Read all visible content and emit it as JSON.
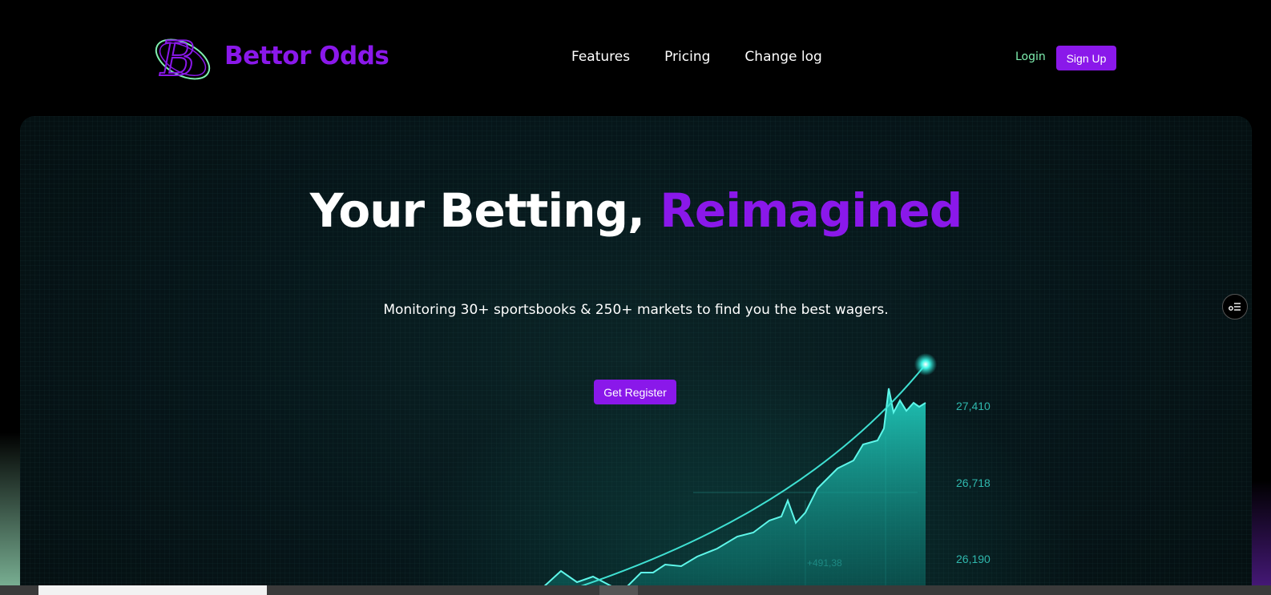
{
  "header": {
    "brand": "Bettor Odds",
    "logo_icon": "bettor-odds-logo-icon",
    "nav": [
      "Features",
      "Pricing",
      "Change log"
    ],
    "login_label": "Login",
    "signup_label": "Sign Up"
  },
  "hero": {
    "title_white": "Your Betting,",
    "title_purple": "Reimagined",
    "subtitle": "Monitoring 30+ sportsbooks & 250+ markets to find you the best wagers.",
    "cta_label": "Get Register",
    "chart_labels": [
      "27,410",
      "26,718",
      "26,190"
    ],
    "chart_annotation": "+491,38"
  },
  "side_widget": {
    "icon": "settings-list-icon"
  },
  "colors": {
    "accent": "#8a18ea",
    "login": "#7ff0b0",
    "teal": "#22d8c8"
  }
}
